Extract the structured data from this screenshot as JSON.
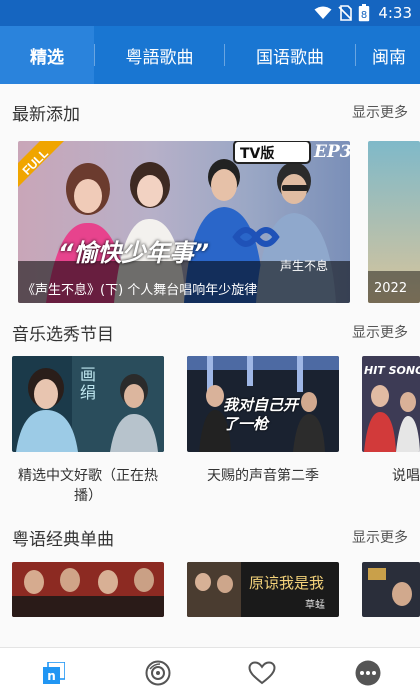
{
  "status_bar": {
    "time": "4:33",
    "battery_level": "8"
  },
  "tabs": [
    {
      "label": "精选",
      "active": true
    },
    {
      "label": "粤語歌曲",
      "active": false
    },
    {
      "label": "国语歌曲",
      "active": false
    },
    {
      "label": "闽南",
      "active": false
    }
  ],
  "sections": {
    "latest": {
      "title": "最新添加",
      "more": "显示更多",
      "banner_main": {
        "corner_tag": "FULL",
        "tv_tag": "TV版",
        "episode": "EP3",
        "headline": "“愉快少年事”",
        "caption_left": "《声生不息》",
        "caption_right": "(下) 个人舞台唱响年少旋律",
        "show_logo_text": "声生不息"
      },
      "banner_peek_caption": "2022"
    },
    "talent": {
      "title": "音乐选秀节目",
      "more": "显示更多",
      "items": [
        {
          "caption": "精选中文好歌（正在热播）",
          "thumb_text": "画绢"
        },
        {
          "caption": "天赐的声音第二季",
          "thumb_text": "我对自己开了一枪"
        },
        {
          "caption": "说唱",
          "thumb_text": "HIT SONG"
        }
      ]
    },
    "cantonese": {
      "title": "粤语经典单曲",
      "more": "显示更多",
      "items": [
        {
          "thumb_text": ""
        },
        {
          "thumb_text": "原谅我是我",
          "sub_text": "草蜢"
        },
        {
          "thumb_text": ""
        }
      ]
    }
  },
  "bottom_nav": [
    {
      "icon": "music-library-icon",
      "active": true
    },
    {
      "icon": "vinyl-disc-icon",
      "active": false
    },
    {
      "icon": "heart-icon",
      "active": false
    },
    {
      "icon": "more-dots-icon",
      "active": false
    }
  ],
  "colors": {
    "primary": "#1976d2",
    "status_bar": "#1565c0",
    "nav_active": "#2196f3"
  }
}
